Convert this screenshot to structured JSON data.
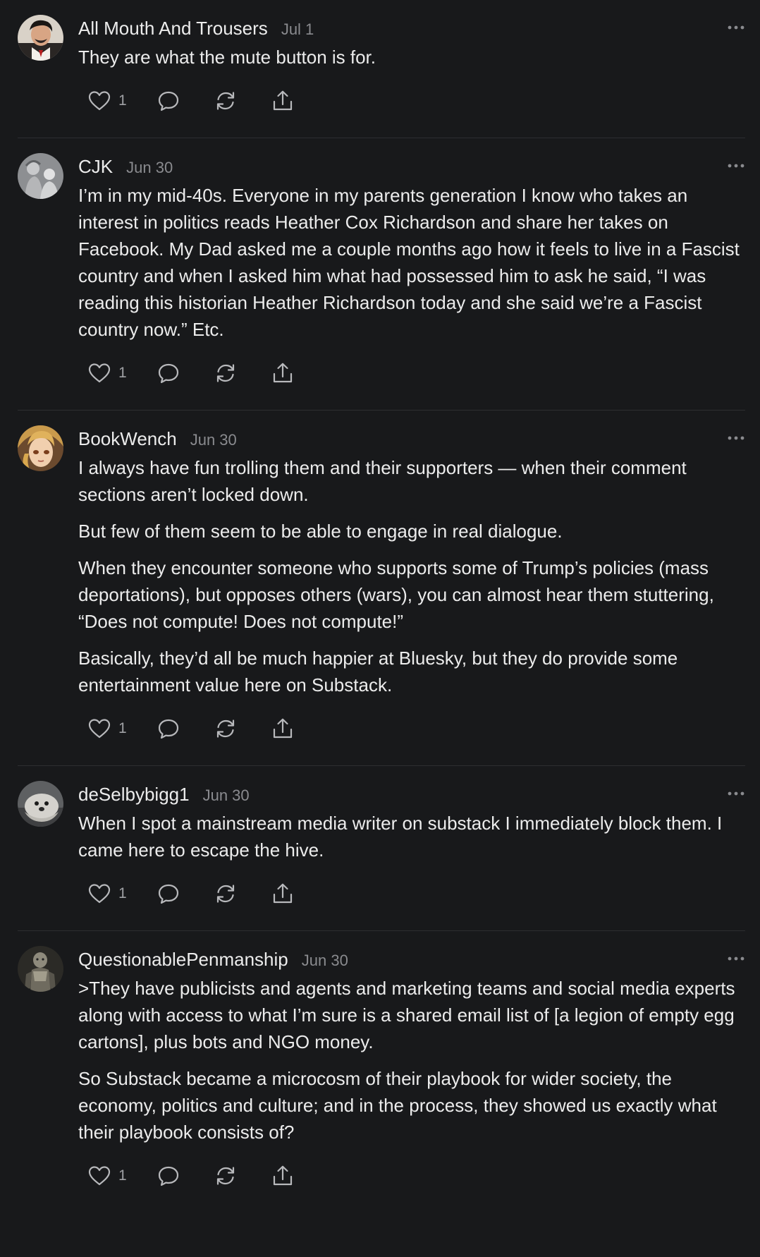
{
  "comments": [
    {
      "author": "All Mouth And Trousers",
      "date": "Jul 1",
      "paragraphs": [
        "They are what the mute button is for."
      ],
      "likes": "1",
      "avatar": "avatar-man-dark-hair"
    },
    {
      "author": "CJK",
      "date": "Jun 30",
      "paragraphs": [
        "I’m in my mid-40s. Everyone in my parents generation I know who takes an interest in politics reads Heather Cox Richardson and share her takes on Facebook. My Dad asked me a couple months ago how it feels to live in a Fascist country and when I asked him what had possessed him to ask he said, “I was reading this historian Heather Richardson today and she said we’re a Fascist country now.” Etc."
      ],
      "likes": "1",
      "avatar": "avatar-gray-figures"
    },
    {
      "author": "BookWench",
      "date": "Jun 30",
      "paragraphs": [
        "I always have fun trolling them and their supporters — when their comment sections aren’t locked down.",
        "But few of them seem to be able to engage in real dialogue.",
        "When they encounter someone who supports some of Trump’s policies (mass deportations), but opposes others (wars), you can almost hear them stuttering, “Does not compute! Does not compute!”",
        "Basically, they’d all be much happier at Bluesky, but they do provide some entertainment value here on Substack."
      ],
      "likes": "1",
      "avatar": "avatar-anime-blonde"
    },
    {
      "author": "deSelbybigg1",
      "date": "Jun 30",
      "paragraphs": [
        "When I spot a mainstream media writer on substack I immediately block them. I came here to escape the hive."
      ],
      "likes": "1",
      "avatar": "avatar-seal"
    },
    {
      "author": "QuestionablePenmanship",
      "date": "Jun 30",
      "paragraphs": [
        ">They have publicists and agents and marketing teams and social media experts along with access to what I’m sure is a shared email list of [a legion of empty egg cartons], plus bots and NGO money.",
        "So Substack became a microcosm of their playbook for wider society, the economy, politics and culture; and in the process, they showed us exactly what their playbook consists of?"
      ],
      "likes": "1",
      "avatar": "avatar-armored-statue"
    }
  ],
  "icons": {
    "like": "heart-icon",
    "reply": "speech-bubble-icon",
    "restack": "restack-arrows-icon",
    "share": "share-icon",
    "more": "ellipsis-icon"
  },
  "colors": {
    "background": "#18191b",
    "text": "#ececec",
    "muted": "#8a8b8f",
    "divider": "#2d2e31"
  }
}
